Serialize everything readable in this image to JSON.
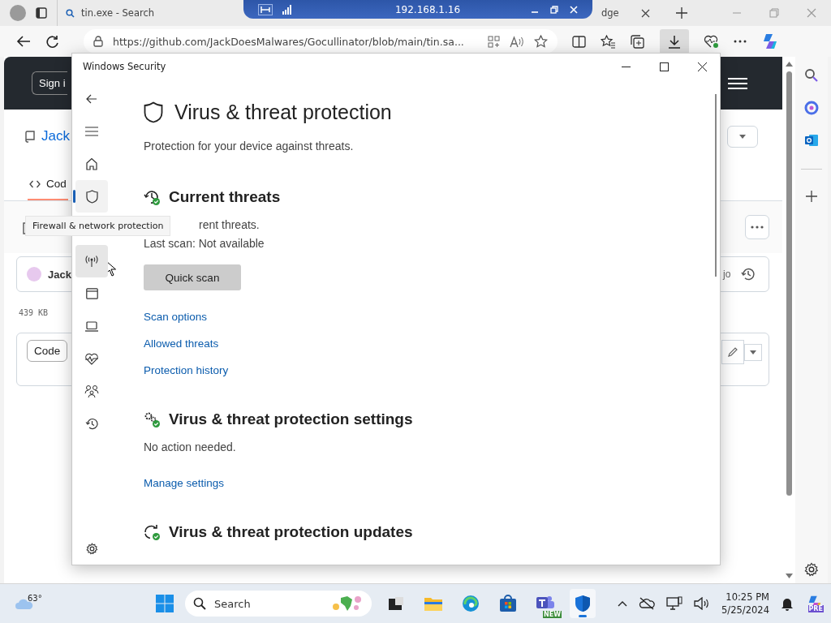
{
  "browser": {
    "tabs": [
      {
        "title": "tin.exe - Search",
        "selected": true
      },
      {
        "title": "dge",
        "selected": false
      }
    ],
    "address": "https://github.com/JackDoesMalwares/Gocullinator/blob/main/tin.sa..."
  },
  "remote_bar": {
    "host": "192.168.1.16"
  },
  "github": {
    "sign_in": "Sign i",
    "repo": "Jack",
    "tab": "Cod",
    "user": "Jack",
    "size": "439  KB",
    "code_button": "Code",
    "cut_text": "jo"
  },
  "security": {
    "title": "Windows Security",
    "nav": [
      {
        "kind": "home",
        "selected": false,
        "hovered": false
      },
      {
        "kind": "shield",
        "selected": true,
        "hovered": false
      },
      {
        "kind": "antenna",
        "selected": false,
        "hovered": true,
        "tooltip": "Firewall & network protection"
      },
      {
        "kind": "app",
        "selected": false,
        "hovered": false
      },
      {
        "kind": "laptop",
        "selected": false,
        "hovered": false
      },
      {
        "kind": "heart",
        "selected": false,
        "hovered": false
      },
      {
        "kind": "family",
        "selected": false,
        "hovered": false
      },
      {
        "kind": "history",
        "selected": false,
        "hovered": false
      }
    ],
    "page": {
      "title": "Virus & threat protection",
      "subtitle": "Protection for your device against threats.",
      "sections": [
        {
          "kind": "threats",
          "heading": "Current threats",
          "lines": [
            {
              "text": "rent threats.",
              "clipped_left": true
            },
            {
              "text": "Last scan: Not available"
            }
          ],
          "button": "Quick scan",
          "links": [
            "Scan options",
            "Allowed threats",
            "Protection history"
          ]
        },
        {
          "kind": "settings",
          "heading": "Virus & threat protection settings",
          "lines": [
            {
              "text": "No action needed."
            }
          ],
          "links": [
            "Manage settings"
          ]
        },
        {
          "kind": "updates",
          "heading": "Virus & threat protection updates"
        }
      ]
    }
  },
  "taskbar": {
    "weather": "63°",
    "search": "Search",
    "apps": [
      {
        "kind": "taskview",
        "selected": false
      },
      {
        "kind": "folder",
        "selected": false
      },
      {
        "kind": "edge",
        "selected": false
      },
      {
        "kind": "store",
        "selected": false
      },
      {
        "kind": "teams",
        "selected": false,
        "badge": "NEW"
      },
      {
        "kind": "security",
        "selected": true
      }
    ],
    "time": "10:25 PM",
    "date": "5/25/2024",
    "copilot_badge": "PRE"
  }
}
